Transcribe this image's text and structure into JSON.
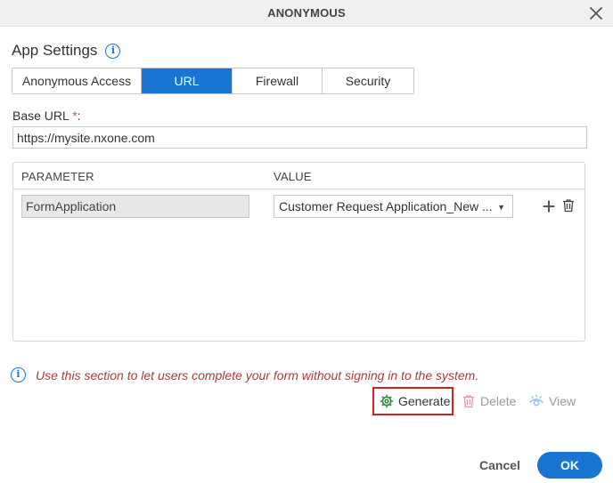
{
  "dialog": {
    "title": "ANONYMOUS"
  },
  "heading": {
    "title": "App Settings",
    "info_glyph": "i"
  },
  "tabs": [
    {
      "label": "Anonymous Access",
      "active": false
    },
    {
      "label": "URL",
      "active": true
    },
    {
      "label": "Firewall",
      "active": false
    },
    {
      "label": "Security",
      "active": false
    }
  ],
  "base_url": {
    "label": "Base URL",
    "required_marker": "*",
    "colon": ":",
    "value": "https://mysite.nxone.com"
  },
  "table": {
    "headers": {
      "parameter": "PARAMETER",
      "value": "VALUE"
    },
    "rows": [
      {
        "parameter": "FormApplication",
        "value": "Customer Request Application_New ..."
      }
    ]
  },
  "hint": {
    "text": "Use this section to let users complete your form without signing in to the system."
  },
  "actions": {
    "generate": "Generate",
    "delete": "Delete",
    "view": "View"
  },
  "footer": {
    "cancel": "Cancel",
    "ok": "OK"
  },
  "colors": {
    "accent": "#1875d1",
    "highlight_border": "#d42020",
    "generate_icon": "#2e8b3a",
    "delete_icon": "#e29a9a",
    "view_icon": "#8ec2ec",
    "hint_text": "#a0413e"
  },
  "icons": {
    "close": "close-icon",
    "info": "info-icon",
    "add": "plus-icon",
    "trash": "trash-icon",
    "generate": "gear-icon",
    "delete": "trash-icon",
    "view": "eye-icon",
    "dropdown": "caret-down-icon"
  }
}
